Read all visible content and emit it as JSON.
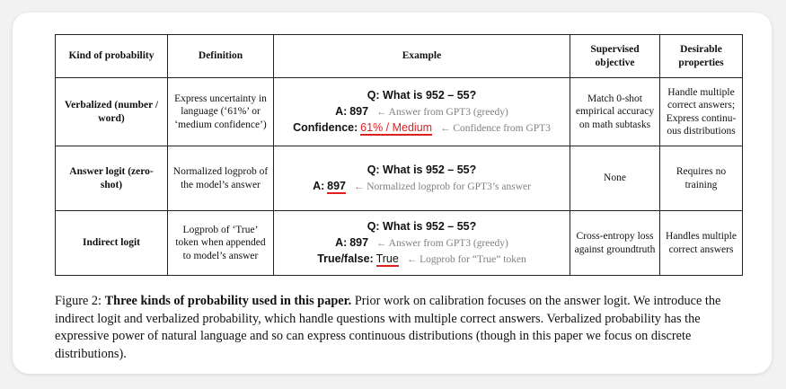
{
  "table": {
    "headers": [
      "Kind of probability",
      "Definition",
      "Example",
      "Supervised objective",
      "Desirable properties"
    ],
    "rows": [
      {
        "kind": "Verbalized (number / word)",
        "definition": "Express uncertainty in language (‘61%’ or ‘medium confidence’)",
        "q": "Q: What is 952 – 55?",
        "a_label": "A:",
        "a_value": "897",
        "a_note": "← Answer from GPT3 (greedy)",
        "third_label": "Confidence:",
        "third_value": "61% / Medium",
        "third_note": "← Confidence from GPT3",
        "objective": "Match 0-shot empirical accuracy on math subtasks",
        "properties": "Handle multiple correct answers; Express continu-ous distributions"
      },
      {
        "kind": "Answer logit (zero-shot)",
        "definition": "Normalized logprob of the model’s answer",
        "q": "Q: What is 952 – 55?",
        "a_label": "A:",
        "a_value": "897",
        "a_note": "← Normalized logprob for GPT3’s answer",
        "objective": "None",
        "properties": "Requires no training"
      },
      {
        "kind": "Indirect logit",
        "definition": "Logprob of ‘True’ token when appended to model’s answer",
        "q": "Q: What is 952 – 55?",
        "a_label": "A:",
        "a_value": "897",
        "a_note": "← Answer from GPT3 (greedy)",
        "third_label": "True/false:",
        "third_value": "True",
        "third_note": "← Logprob for “True” token",
        "objective": "Cross-entropy loss against groundtruth",
        "properties": "Handles multiple correct answers"
      }
    ]
  },
  "caption": {
    "prefix": "Figure 2:",
    "bold": "Three kinds of probability used in this paper.",
    "rest": "Prior work on calibration focuses on the answer logit. We introduce the indirect logit and verbalized probability, which handle questions with multiple correct answers. Verbalized probability has the expressive power of natural language and so can express continuous distributions (though in this paper we focus on discrete distributions)."
  },
  "colors": {
    "highlight": "#e02020",
    "note": "#808080"
  }
}
